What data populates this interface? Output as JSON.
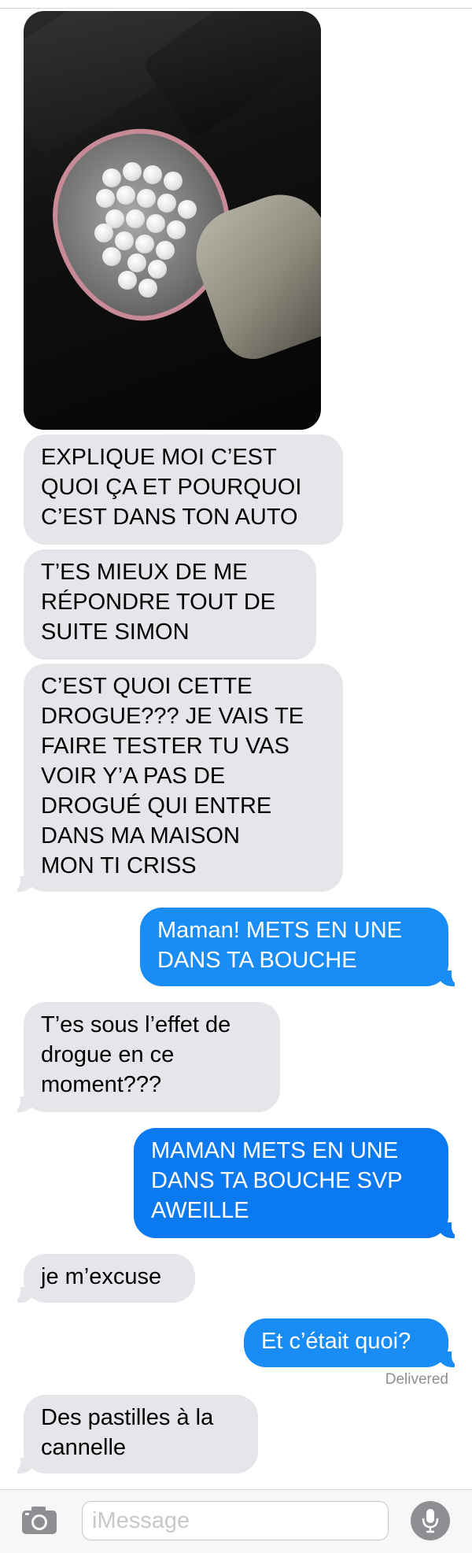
{
  "conversation": {
    "messages": [
      {
        "from": "them",
        "text": "EXPLIQUE MOI C’EST\nQUOI ÇA ET POURQUOI\nC’EST DANS TON AUTO"
      },
      {
        "from": "them",
        "text": "T’ES MIEUX DE ME\nRÉPONDRE TOUT DE\nSUITE SIMON"
      },
      {
        "from": "them",
        "text": "C’EST QUOI CETTE\nDROGUE??? JE VAIS TE\nFAIRE TESTER TU VAS\nVOIR Y’A PAS DE\nDROGUÉ QUI ENTRE\nDANS MA MAISON\nMON TI CRISS"
      },
      {
        "from": "me",
        "text": "Maman! METS EN UNE\nDANS TA BOUCHE"
      },
      {
        "from": "them",
        "text": "T’es sous l’effet de\ndrogue en ce\nmoment???"
      },
      {
        "from": "me",
        "text": "MAMAN METS EN UNE\nDANS TA BOUCHE SVP\nAWEILLE"
      },
      {
        "from": "them",
        "text": "je m’excuse"
      },
      {
        "from": "me",
        "text": "Et c’était quoi?"
      },
      {
        "from": "them",
        "text": "Des pastilles à la\ncannelle"
      }
    ],
    "status": "Delivered"
  },
  "input_bar": {
    "placeholder": "iMessage",
    "camera_icon": "camera-icon",
    "mic_icon": "microphone-icon"
  },
  "colors": {
    "incoming_bubble": "#e5e5ea",
    "outgoing_bubble": "#1a8cf5",
    "status_text": "#8e8e93"
  }
}
